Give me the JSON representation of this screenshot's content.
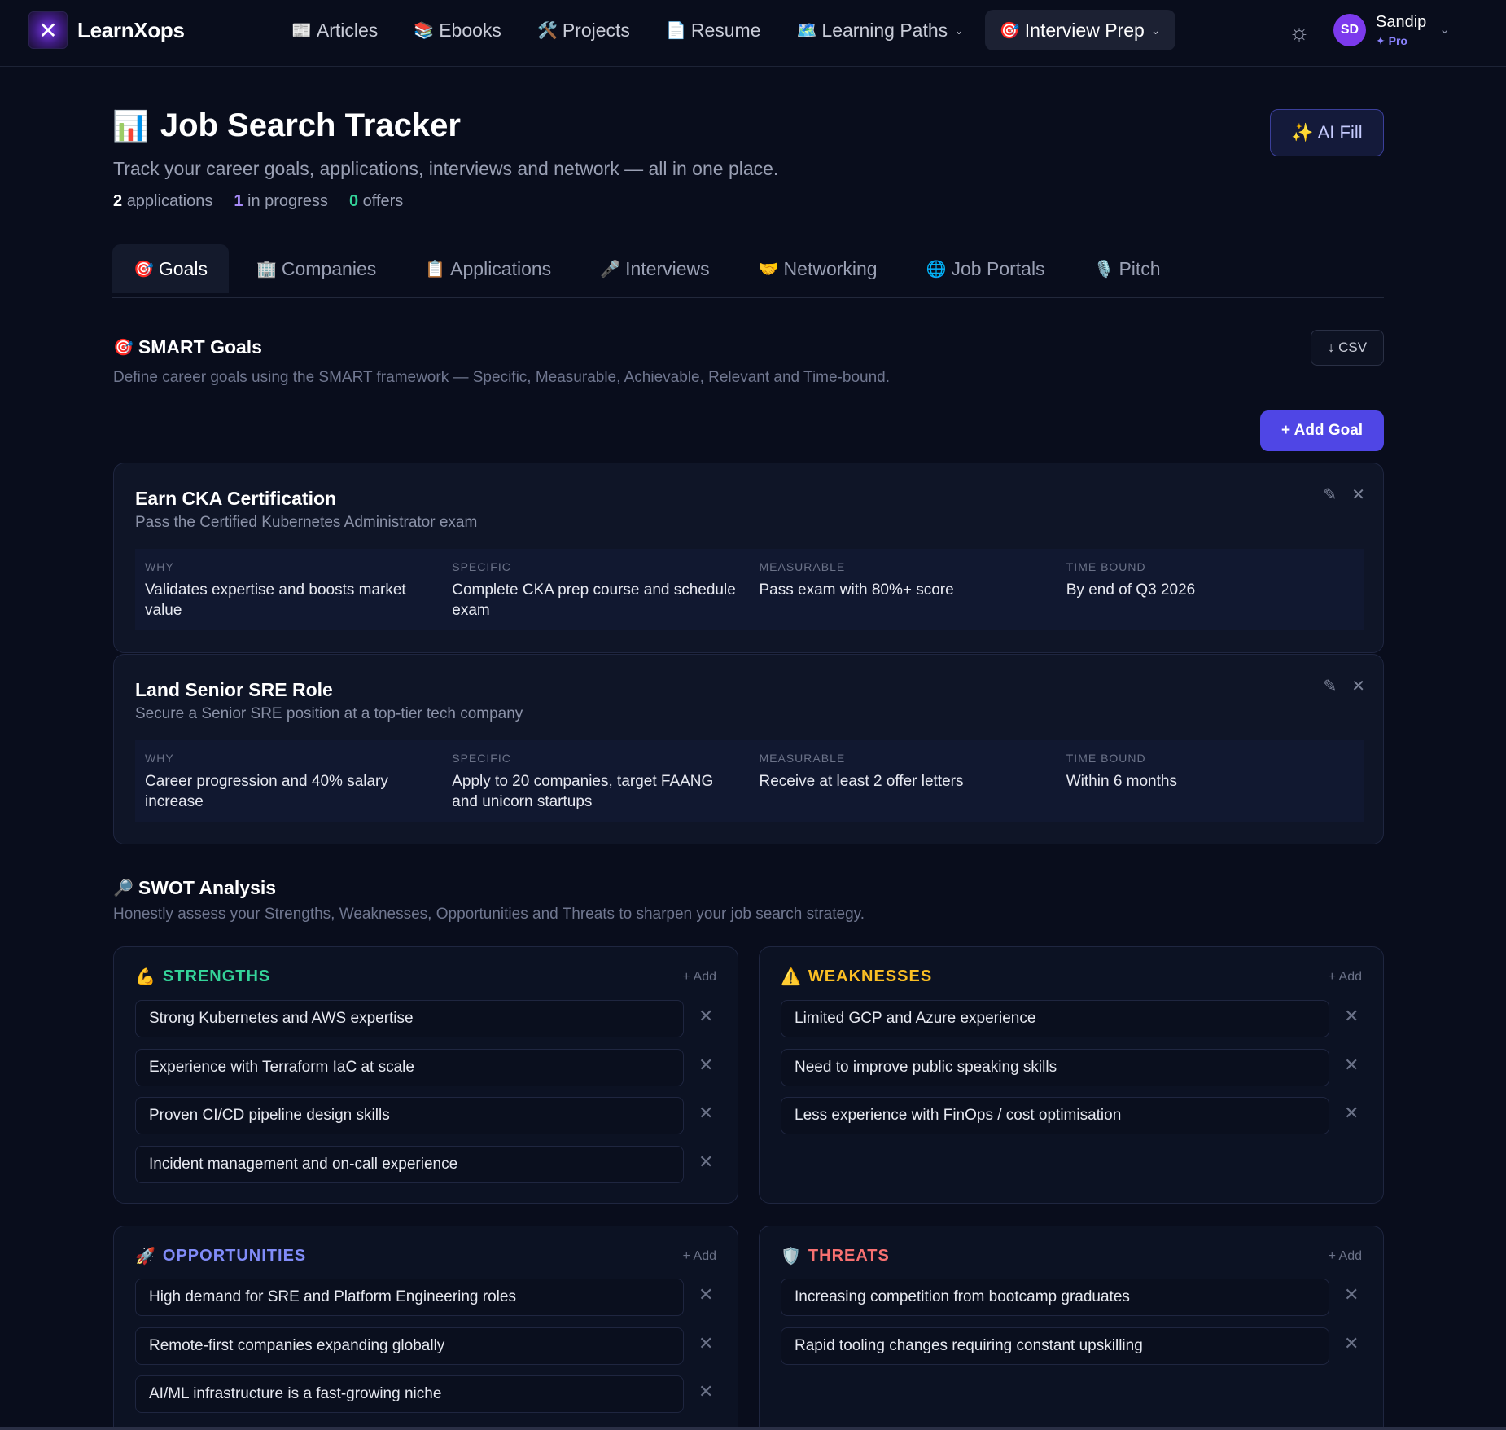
{
  "brand": {
    "name": "LearnXops"
  },
  "nav": {
    "items": [
      {
        "icon": "📰",
        "label": "Articles"
      },
      {
        "icon": "📚",
        "label": "Ebooks"
      },
      {
        "icon": "🛠️",
        "label": "Projects"
      },
      {
        "icon": "📄",
        "label": "Resume"
      },
      {
        "icon": "🗺️",
        "label": "Learning Paths"
      },
      {
        "icon": "🎯",
        "label": "Interview Prep"
      }
    ],
    "theme_icon": "☼"
  },
  "user": {
    "initials": "SD",
    "name": "Sandip",
    "plan": "✦ Pro"
  },
  "header": {
    "icon": "📊",
    "title": "Job Search Tracker",
    "subtitle": "Track your career goals, applications, interviews and network — all in one place.",
    "ai_fill": "✨ AI Fill",
    "stats": {
      "applications_count": "2",
      "applications_label": "applications",
      "progress_count": "1",
      "progress_label": "in progress",
      "offers_count": "0",
      "offers_label": "offers"
    }
  },
  "tabs": [
    {
      "icon": "🎯",
      "label": "Goals"
    },
    {
      "icon": "🏢",
      "label": "Companies"
    },
    {
      "icon": "📋",
      "label": "Applications"
    },
    {
      "icon": "🎤",
      "label": "Interviews"
    },
    {
      "icon": "🤝",
      "label": "Networking"
    },
    {
      "icon": "🌐",
      "label": "Job Portals"
    },
    {
      "icon": "🎙️",
      "label": "Pitch"
    }
  ],
  "smart": {
    "icon": "🎯",
    "title": "SMART Goals",
    "desc": "Define career goals using the SMART framework — Specific, Measurable, Achievable, Relevant and Time-bound.",
    "csv": "↓ CSV",
    "add_goal": "+ Add Goal",
    "goals": [
      {
        "title": "Earn CKA Certification",
        "sub": "Pass the Certified Kubernetes Administrator exam",
        "why_label": "WHY",
        "why": "Validates expertise and boosts market value",
        "specific_label": "SPECIFIC",
        "specific": "Complete CKA prep course and schedule exam",
        "measurable_label": "MEASURABLE",
        "measurable": "Pass exam with 80%+ score",
        "time_label": "TIME BOUND",
        "time": "By end of Q3 2026"
      },
      {
        "title": "Land Senior SRE Role",
        "sub": "Secure a Senior SRE position at a top-tier tech company",
        "why_label": "WHY",
        "why": "Career progression and 40% salary increase",
        "specific_label": "SPECIFIC",
        "specific": "Apply to 20 companies, target FAANG and unicorn startups",
        "measurable_label": "MEASURABLE",
        "measurable": "Receive at least 2 offer letters",
        "time_label": "TIME BOUND",
        "time": "Within 6 months"
      }
    ]
  },
  "swot": {
    "icon": "🔎",
    "title": "SWOT Analysis",
    "desc": "Honestly assess your Strengths, Weaknesses, Opportunities and Threats to sharpen your job search strategy.",
    "add_label": "+ Add",
    "strengths": {
      "icon": "💪",
      "title": "STRENGTHS",
      "items": [
        "Strong Kubernetes and AWS expertise",
        "Experience with Terraform IaC at scale",
        "Proven CI/CD pipeline design skills",
        "Incident management and on-call experience"
      ]
    },
    "weaknesses": {
      "icon": "⚠️",
      "title": "WEAKNESSES",
      "items": [
        "Limited GCP and Azure experience",
        "Need to improve public speaking skills",
        "Less experience with FinOps / cost optimisation"
      ]
    },
    "opportunities": {
      "icon": "🚀",
      "title": "OPPORTUNITIES",
      "items": [
        "High demand for SRE and Platform Engineering roles",
        "Remote-first companies expanding globally",
        "AI/ML infrastructure is a fast-growing niche"
      ]
    },
    "threats": {
      "icon": "🛡️",
      "title": "THREATS",
      "items": [
        "Increasing competition from bootcamp graduates",
        "Rapid tooling changes requiring constant upskilling"
      ]
    }
  },
  "colors": {
    "background": "#090d1c",
    "accent": "#4f46e5",
    "strengths": "#34d399",
    "weaknesses": "#fbbf24",
    "opportunities": "#818cf8",
    "threats": "#f87171"
  }
}
